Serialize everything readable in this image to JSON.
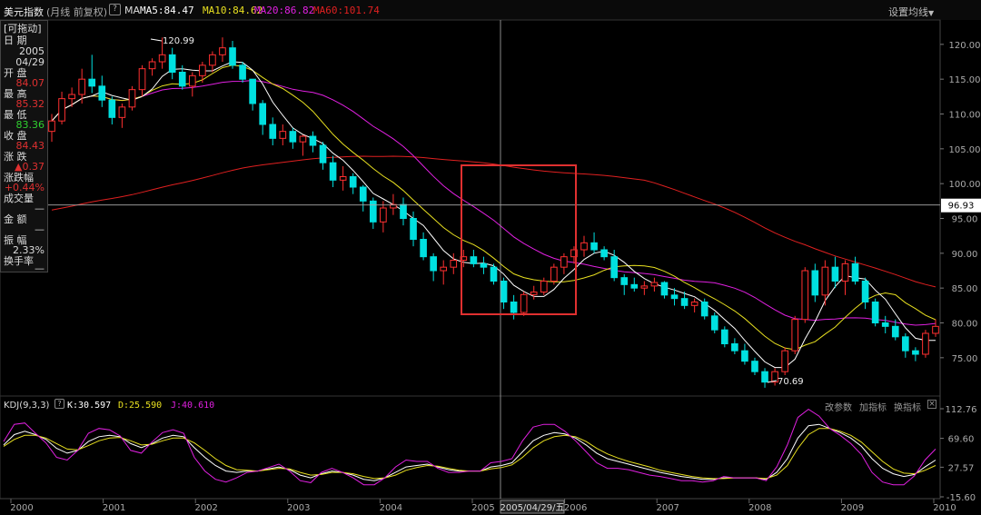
{
  "header": {
    "instrument": "美元指数",
    "period_info": "(月线 前复权)",
    "help": "?",
    "ma_label": "MA",
    "ma5": {
      "label": "MA5:84.47",
      "color": "#ffffff"
    },
    "ma10": {
      "label": "MA10:84.62",
      "color": "#e8e020"
    },
    "ma20": {
      "label": "MA20:86.82",
      "color": "#e020e0"
    },
    "ma60": {
      "label": "MA60:101.74",
      "color": "#e02020"
    },
    "settings_label": "设置均线"
  },
  "info_panel": {
    "title": "[可拖动]",
    "date_label": "日  期",
    "date_year": "2005",
    "date_md": "04/29",
    "open_label": "开  盘",
    "open_value": "84.07",
    "high_label": "最  高",
    "high_value": "85.32",
    "low_label": "最  低",
    "low_value": "83.36",
    "close_label": "收  盘",
    "close_value": "84.43",
    "change_label": "涨  跌",
    "change_value": "▲0.37",
    "pct_label": "涨跌幅",
    "pct_value": "+0.44%",
    "volume_label": "成交量",
    "volume_value": "—",
    "amount_label": "金  额",
    "amount_value": "—",
    "amplitude_label": "振  幅",
    "amplitude_value": "2.33%",
    "turnover_label": "换手率",
    "turnover_value": "—"
  },
  "kdj": {
    "title": "KDJ(9,3,3)",
    "k_label": "K:30.597",
    "d_label": "D:25.590",
    "j_label": "J:40.610",
    "buttons": [
      "改参数",
      "加指标",
      "换指标"
    ],
    "k_color": "#ffffff",
    "d_color": "#e8e020",
    "j_color": "#e020e0"
  },
  "crosshair": {
    "price_label": "96.93",
    "date_label": "2005/04/29/五"
  },
  "annotations": {
    "high_label": "120.99",
    "low_label": "70.69"
  },
  "chart_data": [
    {
      "type": "candlestick",
      "x": [
        "2000",
        "2001",
        "2002",
        "2003",
        "2004",
        "2005",
        "2006",
        "2007",
        "2008",
        "2009",
        "2010"
      ],
      "ylim": [
        69.5,
        123.5
      ],
      "y_ticks": [
        75.0,
        80.0,
        85.0,
        90.0,
        95.0,
        100.0,
        105.0,
        110.0,
        115.0,
        120.0
      ],
      "current_price": 96.93,
      "grid": false,
      "colors": {
        "up": "#ff3030",
        "down": "#00e0e0"
      },
      "ohlc": [
        [
          107.5,
          110.0,
          106.0,
          109.0
        ],
        [
          109.0,
          113.2,
          108.5,
          112.2
        ],
        [
          112.2,
          113.8,
          111.0,
          112.8
        ],
        [
          112.8,
          116.5,
          111.5,
          115.0
        ],
        [
          115.0,
          118.5,
          113.0,
          114.0
        ],
        [
          114.0,
          115.5,
          111.0,
          112.0
        ],
        [
          112.0,
          112.5,
          108.5,
          109.5
        ],
        [
          109.5,
          111.5,
          108.0,
          111.0
        ],
        [
          111.0,
          114.0,
          110.5,
          113.5
        ],
        [
          113.5,
          117.0,
          112.5,
          116.5
        ],
        [
          116.5,
          118.0,
          115.5,
          117.5
        ],
        [
          117.5,
          120.99,
          116.5,
          118.5
        ],
        [
          118.5,
          119.5,
          115.0,
          116.0
        ],
        [
          116.0,
          117.0,
          113.5,
          114.0
        ],
        [
          114.0,
          116.0,
          112.5,
          115.5
        ],
        [
          115.5,
          117.5,
          114.5,
          117.0
        ],
        [
          117.0,
          119.0,
          116.0,
          118.5
        ],
        [
          118.5,
          121.0,
          117.5,
          119.5
        ],
        [
          119.5,
          120.5,
          116.5,
          117.0
        ],
        [
          117.0,
          117.5,
          114.5,
          115.0
        ],
        [
          115.0,
          115.0,
          110.5,
          111.5
        ],
        [
          111.5,
          112.0,
          107.0,
          108.5
        ],
        [
          108.5,
          109.5,
          105.5,
          106.5
        ],
        [
          106.5,
          108.5,
          105.5,
          107.5
        ],
        [
          107.5,
          108.0,
          105.0,
          106.0
        ],
        [
          106.0,
          107.0,
          104.0,
          106.8
        ],
        [
          106.8,
          107.5,
          104.5,
          105.5
        ],
        [
          105.5,
          106.0,
          102.0,
          103.0
        ],
        [
          103.0,
          104.0,
          99.5,
          100.5
        ],
        [
          100.5,
          102.5,
          99.0,
          101.0
        ],
        [
          101.0,
          101.5,
          98.5,
          99.5
        ],
        [
          99.5,
          99.8,
          96.0,
          97.5
        ],
        [
          97.5,
          98.0,
          93.5,
          94.5
        ],
        [
          94.5,
          97.5,
          93.0,
          96.5
        ],
        [
          96.5,
          98.5,
          95.5,
          97.0
        ],
        [
          97.0,
          98.0,
          94.0,
          95.0
        ],
        [
          95.0,
          96.0,
          91.0,
          92.0
        ],
        [
          92.0,
          93.0,
          89.0,
          89.5
        ],
        [
          89.5,
          90.0,
          86.0,
          87.5
        ],
        [
          87.5,
          89.0,
          85.5,
          88.0
        ],
        [
          88.0,
          90.0,
          87.0,
          89.0
        ],
        [
          89.0,
          90.5,
          88.0,
          89.5
        ],
        [
          89.5,
          90.5,
          88.0,
          88.5
        ],
        [
          88.5,
          89.5,
          87.0,
          88.0
        ],
        [
          88.0,
          88.5,
          85.5,
          86.0
        ],
        [
          86.0,
          86.5,
          82.0,
          83.0
        ],
        [
          83.0,
          84.0,
          80.5,
          81.5
        ],
        [
          81.5,
          84.5,
          81.0,
          84.07
        ],
        [
          84.07,
          85.32,
          83.36,
          84.43
        ],
        [
          84.43,
          86.5,
          84.0,
          86.0
        ],
        [
          86.0,
          88.5,
          85.5,
          88.0
        ],
        [
          88.0,
          90.0,
          87.0,
          89.5
        ],
        [
          89.5,
          91.0,
          88.5,
          90.5
        ],
        [
          90.5,
          92.5,
          89.5,
          91.5
        ],
        [
          91.5,
          93.0,
          90.0,
          90.5
        ],
        [
          90.5,
          91.0,
          89.0,
          89.5
        ],
        [
          89.5,
          90.5,
          86.0,
          86.5
        ],
        [
          86.5,
          87.0,
          84.0,
          85.5
        ],
        [
          85.5,
          86.5,
          84.5,
          85.0
        ],
        [
          85.0,
          86.0,
          84.0,
          85.3
        ],
        [
          85.3,
          86.5,
          84.5,
          85.8
        ],
        [
          85.8,
          86.0,
          83.5,
          84.0
        ],
        [
          84.0,
          85.0,
          82.5,
          83.5
        ],
        [
          83.5,
          84.5,
          82.0,
          82.5
        ],
        [
          82.5,
          83.5,
          81.5,
          83.0
        ],
        [
          83.0,
          83.5,
          80.5,
          81.0
        ],
        [
          81.0,
          81.5,
          78.5,
          79.0
        ],
        [
          79.0,
          79.5,
          76.5,
          77.0
        ],
        [
          77.0,
          77.8,
          75.5,
          76.0
        ],
        [
          76.0,
          77.0,
          74.0,
          74.5
        ],
        [
          74.5,
          75.0,
          72.5,
          73.0
        ],
        [
          73.0,
          73.5,
          70.69,
          71.5
        ],
        [
          71.5,
          73.5,
          71.0,
          73.0
        ],
        [
          73.0,
          76.5,
          72.5,
          76.0
        ],
        [
          76.0,
          81.0,
          75.5,
          80.5
        ],
        [
          80.5,
          88.0,
          80.0,
          87.5
        ],
        [
          87.5,
          88.5,
          83.0,
          84.0
        ],
        [
          84.0,
          89.0,
          82.5,
          88.0
        ],
        [
          88.0,
          89.5,
          85.0,
          86.0
        ],
        [
          86.0,
          89.0,
          84.0,
          88.5
        ],
        [
          88.5,
          89.5,
          85.5,
          86.0
        ],
        [
          86.0,
          86.5,
          82.0,
          83.0
        ],
        [
          83.0,
          83.5,
          79.5,
          80.0
        ],
        [
          80.0,
          81.0,
          78.5,
          79.5
        ],
        [
          79.5,
          80.5,
          77.5,
          78.0
        ],
        [
          78.0,
          78.5,
          75.0,
          76.0
        ],
        [
          76.0,
          76.5,
          74.5,
          75.5
        ],
        [
          75.5,
          79.0,
          75.0,
          78.5
        ],
        [
          78.5,
          80.5,
          78.0,
          79.5
        ]
      ]
    },
    {
      "type": "line",
      "title": "KDJ(9,3,3)",
      "ylim": [
        -15.6,
        112.76
      ],
      "y_ticks": [
        112.76,
        69.6,
        27.57,
        -15.6
      ],
      "series": [
        {
          "name": "K",
          "values": [
            60,
            75,
            80,
            75,
            68,
            55,
            48,
            52,
            65,
            72,
            74,
            72,
            62,
            56,
            62,
            70,
            74,
            72,
            56,
            42,
            30,
            22,
            20,
            22,
            22,
            25,
            28,
            24,
            16,
            12,
            18,
            22,
            20,
            16,
            10,
            8,
            12,
            20,
            28,
            30,
            32,
            28,
            24,
            22,
            22,
            22,
            28,
            30,
            34,
            50,
            66,
            74,
            78,
            76,
            70,
            60,
            48,
            40,
            36,
            32,
            28,
            24,
            20,
            17,
            14,
            12,
            10,
            10,
            12,
            12,
            12,
            12,
            10,
            20,
            40,
            70,
            88,
            90,
            84,
            78,
            70,
            58,
            40,
            26,
            18,
            14,
            17,
            28,
            38
          ]
        },
        {
          "name": "D",
          "values": [
            58,
            68,
            74,
            74,
            70,
            62,
            54,
            53,
            59,
            66,
            70,
            71,
            66,
            60,
            61,
            66,
            70,
            70,
            63,
            52,
            40,
            30,
            24,
            23,
            22,
            24,
            26,
            25,
            20,
            16,
            17,
            20,
            20,
            18,
            14,
            11,
            12,
            16,
            23,
            27,
            30,
            29,
            26,
            23,
            22,
            22,
            25,
            27,
            31,
            42,
            56,
            66,
            72,
            74,
            72,
            65,
            55,
            47,
            41,
            36,
            32,
            28,
            23,
            20,
            17,
            14,
            12,
            11,
            11,
            12,
            12,
            12,
            11,
            16,
            30,
            55,
            75,
            84,
            84,
            80,
            74,
            64,
            50,
            36,
            25,
            19,
            18,
            23,
            30
          ]
        },
        {
          "name": "J",
          "values": [
            65,
            90,
            92,
            77,
            63,
            42,
            38,
            52,
            77,
            84,
            82,
            73,
            52,
            48,
            64,
            78,
            82,
            77,
            42,
            22,
            10,
            6,
            12,
            20,
            22,
            27,
            32,
            22,
            8,
            5,
            20,
            26,
            20,
            12,
            2,
            2,
            12,
            28,
            38,
            36,
            36,
            26,
            20,
            20,
            22,
            22,
            34,
            36,
            40,
            66,
            86,
            90,
            90,
            80,
            66,
            50,
            34,
            26,
            26,
            24,
            20,
            16,
            14,
            11,
            8,
            8,
            6,
            8,
            14,
            12,
            12,
            12,
            8,
            28,
            60,
            100,
            112,
            102,
            84,
            74,
            62,
            46,
            20,
            6,
            2,
            2,
            15,
            38,
            54
          ]
        }
      ]
    }
  ]
}
